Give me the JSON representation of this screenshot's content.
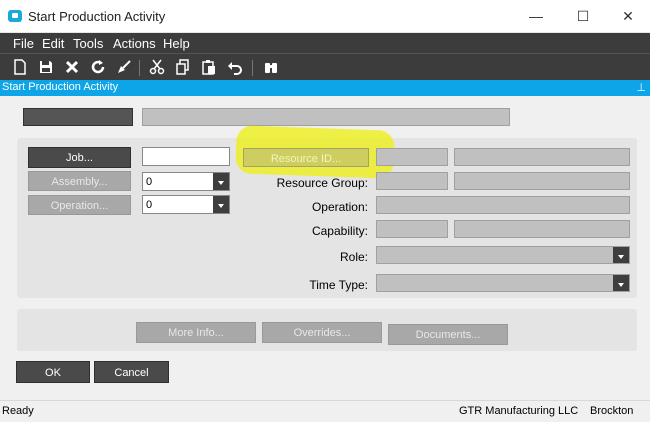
{
  "window": {
    "title": "Start Production Activity",
    "minimize_glyph": "—",
    "maximize_glyph": "☐",
    "close_glyph": "✕"
  },
  "menu": [
    {
      "label": "File"
    },
    {
      "label": "Edit"
    },
    {
      "label": "Tools"
    },
    {
      "label": "Actions"
    },
    {
      "label": "Help"
    }
  ],
  "toolbar_icons": [
    "new-document-icon",
    "save-icon",
    "delete-icon",
    "refresh-icon",
    "clear-icon",
    "cut-icon",
    "copy-icon",
    "paste-icon",
    "undo-icon",
    "search-binoculars-icon"
  ],
  "panel": {
    "title": "Start Production Activity",
    "pin_glyph": "⊥"
  },
  "form": {
    "job_button": "Job...",
    "job_value": "",
    "assembly_button": "Assembly...",
    "assembly_value": "0",
    "operation_button": "Operation...",
    "operation_value": "0",
    "resource_id_button": "Resource ID...",
    "resource_group_label": "Resource Group:",
    "operation_label": "Operation:",
    "capability_label": "Capability:",
    "role_label": "Role:",
    "time_type_label": "Time Type:"
  },
  "actions": {
    "more_info": "More Info...",
    "overrides": "Overrides...",
    "documents": "Documents..."
  },
  "dialog_buttons": {
    "ok": "OK",
    "cancel": "Cancel"
  },
  "status": {
    "text": "Ready",
    "company": "GTR Manufacturing LLC",
    "site": "Brockton"
  },
  "colors": {
    "accent": "#0ea5e8",
    "menubar": "#3c3c3c",
    "highlight": "#eef014"
  }
}
